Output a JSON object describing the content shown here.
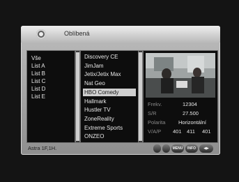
{
  "header": {
    "title": "Oblíbená",
    "icon": "satellite-dish-icon"
  },
  "groups": [
    {
      "label": "Vše"
    },
    {
      "label": "List A"
    },
    {
      "label": "List B"
    },
    {
      "label": "List C"
    },
    {
      "label": "List D"
    },
    {
      "label": "List E"
    }
  ],
  "channels": [
    {
      "label": "Discovery CE"
    },
    {
      "label": "JimJam"
    },
    {
      "label": "Jetix/Jetix Max"
    },
    {
      "label": "Nat Geo"
    },
    {
      "label": "HBO Comedy"
    },
    {
      "label": "Hallmark"
    },
    {
      "label": "Hustler TV"
    },
    {
      "label": "ZoneReality"
    },
    {
      "label": "Extreme Sports"
    },
    {
      "label": "ONZEO"
    }
  ],
  "selected_channel": "HBO Comedy",
  "info": {
    "freq_label": "Frekv.",
    "freq_value": "12304",
    "sr_label": "S/R",
    "sr_value": "27.500",
    "pol_label": "Polarita",
    "pol_value": "Horizontální",
    "vap_label": "V/A/P",
    "vap_values": [
      "401",
      "411",
      "401"
    ]
  },
  "footer": {
    "satellite": "Astra 1F,1H.",
    "buttons": [
      "",
      "",
      "MENU",
      "INFO",
      "◀▶"
    ]
  }
}
